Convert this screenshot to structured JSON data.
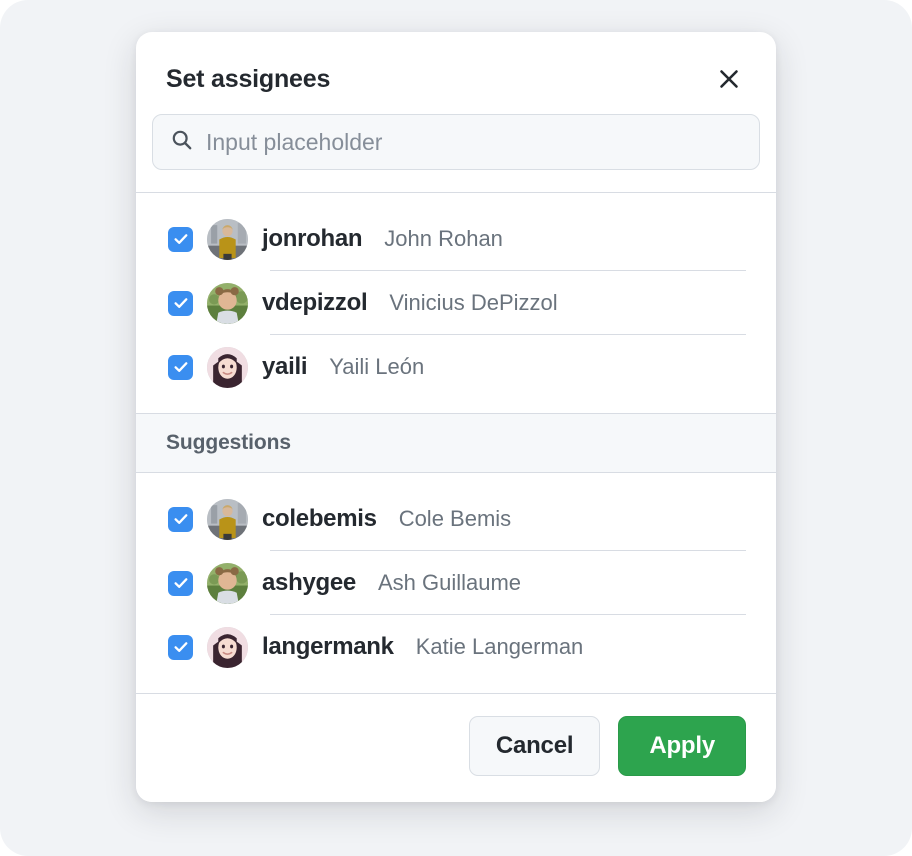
{
  "dialog": {
    "title": "Set assignees",
    "close_icon": "close-icon"
  },
  "search": {
    "icon": "search-icon",
    "value": "",
    "placeholder": "Input placeholder"
  },
  "selected_section": {
    "people": [
      {
        "login": "jonrohan",
        "name": "John Rohan",
        "checked": true,
        "avatar": {
          "bg": "#8e9197",
          "sky": "#b9bec4",
          "ground": "#6e7278",
          "skin": "#d8b89a",
          "hair": "#caa86a",
          "clothes": "#b99318"
        }
      },
      {
        "login": "vdepizzol",
        "name": "Vinicius DePizzol",
        "checked": true,
        "avatar": {
          "bg": "#7fa05a",
          "sky": "#93b06a",
          "ground": "#5d7f3d",
          "skin": "#e0b694",
          "hair": "#8a6a44",
          "clothes": "#d9dee4"
        }
      },
      {
        "login": "yaili",
        "name": "Yaili León",
        "checked": true,
        "avatar": {
          "bg": "#e6cfd6",
          "sky": "#f0dde2",
          "ground": "#d8bcc6",
          "skin": "#f2d3c8",
          "hair": "#3a2430",
          "clothes": "#c8a6b2"
        }
      }
    ]
  },
  "suggestions_section": {
    "label": "Suggestions",
    "people": [
      {
        "login": "colebemis",
        "name": "Cole Bemis",
        "checked": true,
        "avatar": {
          "bg": "#8e9197",
          "sky": "#b9bec4",
          "ground": "#6e7278",
          "skin": "#d8b89a",
          "hair": "#caa86a",
          "clothes": "#b99318"
        }
      },
      {
        "login": "ashygee",
        "name": "Ash Guillaume",
        "checked": true,
        "avatar": {
          "bg": "#7fa05a",
          "sky": "#93b06a",
          "ground": "#5d7f3d",
          "skin": "#e0b694",
          "hair": "#8a6a44",
          "clothes": "#d9dee4"
        }
      },
      {
        "login": "langermank",
        "name": "Katie Langerman",
        "checked": true,
        "avatar": {
          "bg": "#e6cfd6",
          "sky": "#f0dde2",
          "ground": "#d8bcc6",
          "skin": "#f2d3c8",
          "hair": "#3a2430",
          "clothes": "#c8a6b2"
        }
      }
    ]
  },
  "footer": {
    "cancel_label": "Cancel",
    "apply_label": "Apply"
  },
  "colors": {
    "accent_blue": "#3a8ef0",
    "primary_green": "#2da44e",
    "text": "#24292f",
    "muted_text": "#6a737d",
    "border": "#d8dce3",
    "surface_subtle": "#f6f8fa",
    "page_background": "#f1f3f6"
  }
}
